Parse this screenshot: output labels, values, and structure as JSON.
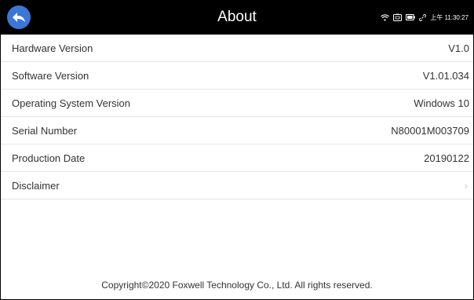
{
  "header": {
    "title": "About",
    "time": "上午 11:30:27",
    "back_icon": "back-arrow-icon",
    "status_icons": [
      "wifi-icon",
      "vci-icon",
      "battery-icon",
      "link-icon"
    ]
  },
  "rows": [
    {
      "label": "Hardware Version",
      "value": "V1.0"
    },
    {
      "label": "Software Version",
      "value": "V1.01.034"
    },
    {
      "label": "Operating System Version",
      "value": "Windows 10"
    },
    {
      "label": "Serial Number",
      "value": "N80001M003709"
    },
    {
      "label": "Production Date",
      "value": "20190122"
    }
  ],
  "disclaimer": {
    "label": "Disclaimer",
    "chevron": "›"
  },
  "footer": {
    "copyright": "Copyright©2020 Foxwell Technology Co., Ltd. All rights reserved."
  },
  "colors": {
    "header_bg": "#000000",
    "back_button": "#3a78d6",
    "divider": "#e6e6e6"
  }
}
